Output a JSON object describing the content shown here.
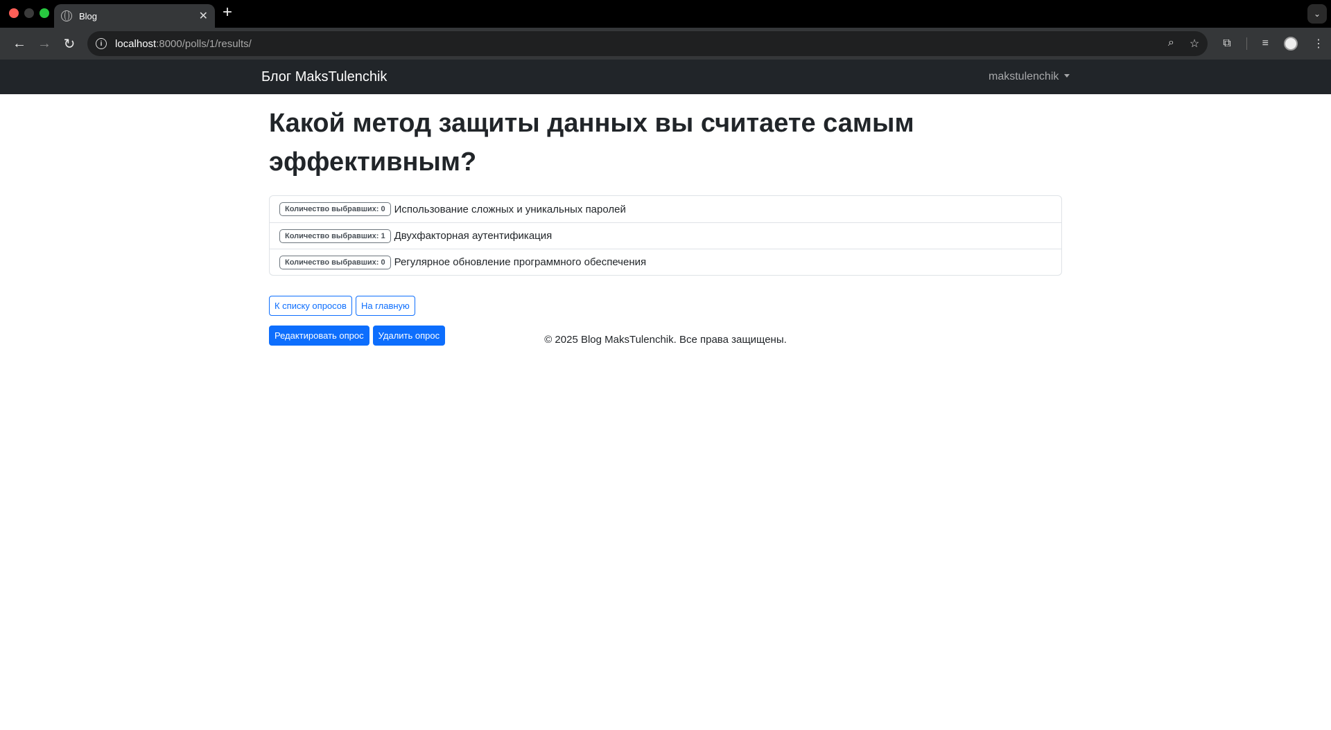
{
  "browser": {
    "tab_title": "Blog",
    "tab_close": "✕",
    "new_tab": "+",
    "url_host": "localhost",
    "url_rest": ":8000/polls/1/results/"
  },
  "site": {
    "brand": "Блог MaksTulenchik",
    "user": "makstulenchik"
  },
  "poll": {
    "question": "Какой метод защиты данных вы считаете самым эффективным?",
    "choices": [
      {
        "badge": "Количество выбравших: 0",
        "text": "Использование сложных и уникальных паролей"
      },
      {
        "badge": "Количество выбравших: 1",
        "text": "Двухфакторная аутентификация"
      },
      {
        "badge": "Количество выбравших: 0",
        "text": "Регулярное обновление программного обеспечения"
      }
    ]
  },
  "buttons": {
    "to_polls": "К списку опросов",
    "to_home": "На главную",
    "edit": "Редактировать опрос",
    "delete": "Удалить опрос"
  },
  "footer": {
    "text": "© 2025 Blog MaksTulenchik. Все права защищены."
  },
  "colors": {
    "primary": "#0d6efd",
    "navbar": "#212529"
  }
}
